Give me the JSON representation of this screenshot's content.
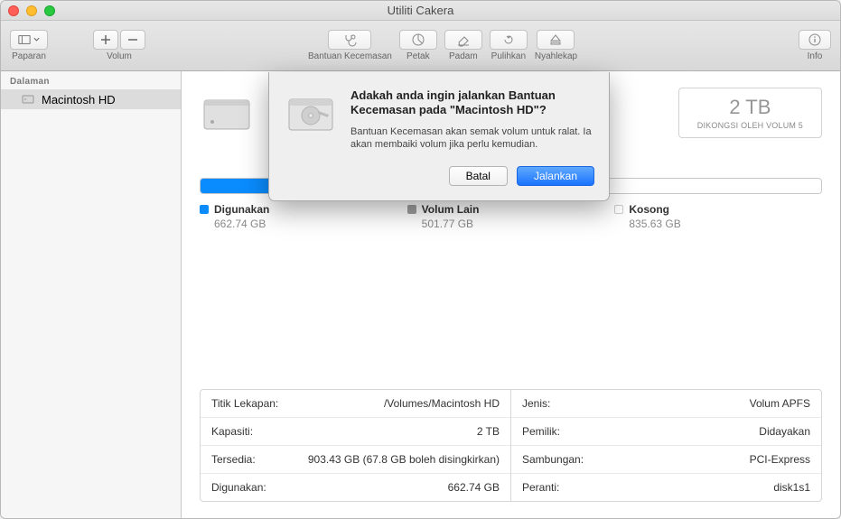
{
  "window": {
    "title": "Utiliti Cakera"
  },
  "toolbar": {
    "view_label": "Paparan",
    "volume_label": "Volum",
    "firstaid_label": "Bantuan Kecemasan",
    "partition_label": "Petak",
    "erase_label": "Padam",
    "restore_label": "Pulihkan",
    "unmount_label": "Nyahlekap",
    "info_label": "Info"
  },
  "sidebar": {
    "internal_header": "Dalaman",
    "items": [
      {
        "label": "Macintosh HD"
      }
    ]
  },
  "capacity": {
    "value": "2 TB",
    "subtitle": "DIKONGSI OLEH VOLUM 5"
  },
  "legend": {
    "used_label": "Digunakan",
    "used_value": "662.74 GB",
    "other_label": "Volum Lain",
    "other_value": "501.77 GB",
    "free_label": "Kosong",
    "free_value": "835.63 GB"
  },
  "details": {
    "left": [
      {
        "key": "Titik Lekapan:",
        "val": "/Volumes/Macintosh HD"
      },
      {
        "key": "Kapasiti:",
        "val": "2 TB"
      },
      {
        "key": "Tersedia:",
        "val": "903.43 GB (67.8 GB boleh disingkirkan)"
      },
      {
        "key": "Digunakan:",
        "val": "662.74 GB"
      }
    ],
    "right": [
      {
        "key": "Jenis:",
        "val": "Volum APFS"
      },
      {
        "key": "Pemilik:",
        "val": "Didayakan"
      },
      {
        "key": "Sambungan:",
        "val": "PCI-Express"
      },
      {
        "key": "Peranti:",
        "val": "disk1s1"
      }
    ]
  },
  "dialog": {
    "title": "Adakah anda ingin jalankan Bantuan Kecemasan pada \"Macintosh HD\"?",
    "desc": "Bantuan Kecemasan akan semak volum untuk ralat. Ia akan membaiki volum jika perlu kemudian.",
    "cancel": "Batal",
    "run": "Jalankan"
  }
}
